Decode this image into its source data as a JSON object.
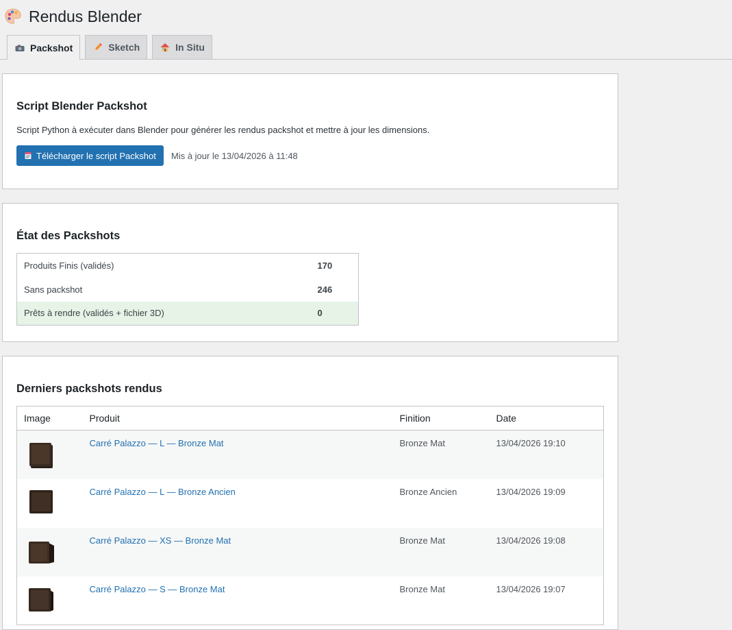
{
  "page": {
    "title": "Rendus Blender",
    "icon": "palette-icon"
  },
  "tabs": [
    {
      "label": "Packshot",
      "icon": "camera-icon",
      "active": true
    },
    {
      "label": "Sketch",
      "icon": "pencil-icon",
      "active": false
    },
    {
      "label": "In Situ",
      "icon": "house-icon",
      "active": false
    }
  ],
  "script_card": {
    "title": "Script Blender Packshot",
    "description": "Script Python à exécuter dans Blender pour générer les rendus packshot et mettre à jour les dimensions.",
    "download_label": "Télécharger le script Packshot",
    "download_icon": "script-icon",
    "updated_text": "Mis à jour le 13/04/2026 à 11:48"
  },
  "status_card": {
    "title": "État des Packshots",
    "rows": [
      {
        "label": "Produits Finis (validés)",
        "value": "170",
        "color": "#3c434a"
      },
      {
        "label": "Sans packshot",
        "value": "246",
        "color": "#d63638"
      },
      {
        "label": "Prêts à rendre (validés + fichier 3D)",
        "value": "0",
        "color": "#00a32a"
      }
    ]
  },
  "renders_card": {
    "title": "Derniers packshots rendus",
    "columns": {
      "image": "Image",
      "product": "Produit",
      "finish": "Finition",
      "date": "Date"
    },
    "rows": [
      {
        "product": "Carré Palazzo — L — Bronze Mat",
        "finish": "Bronze Mat",
        "date": "13/04/2026 19:10"
      },
      {
        "product": "Carré Palazzo — L — Bronze Ancien",
        "finish": "Bronze Ancien",
        "date": "13/04/2026 19:09"
      },
      {
        "product": "Carré Palazzo — XS — Bronze Mat",
        "finish": "Bronze Mat",
        "date": "13/04/2026 19:08"
      },
      {
        "product": "Carré Palazzo — S — Bronze Mat",
        "finish": "Bronze Mat",
        "date": "13/04/2026 19:07"
      }
    ]
  },
  "colors": {
    "accent": "#2271b1",
    "danger": "#d63638",
    "success": "#00a32a"
  }
}
